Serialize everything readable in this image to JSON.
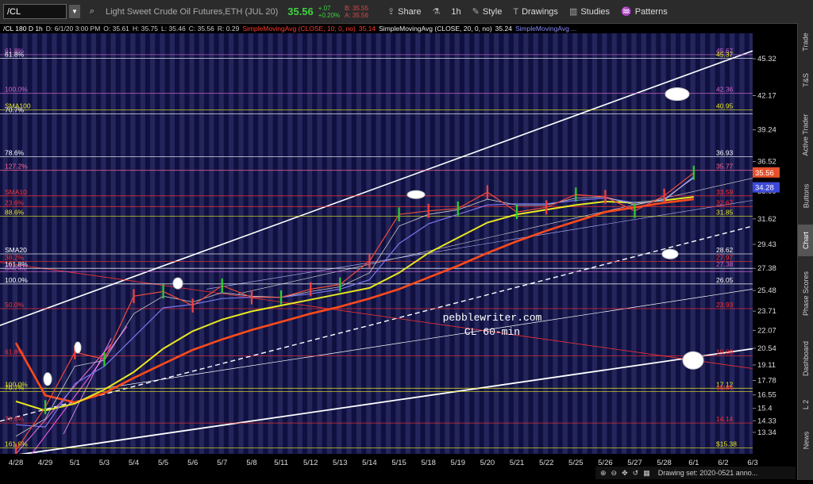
{
  "toolbar": {
    "symbol": "/CL",
    "description": "Light Sweet Crude Oil Futures,ETH (JUL 20)",
    "last": "35.56",
    "change": "+.07",
    "change_pct": "+0.20%",
    "bid": "B: 35.55",
    "ask": "A: 35.56",
    "share": "Share",
    "timeframe": "1h",
    "style": "Style",
    "drawings": "Drawings",
    "studies": "Studies",
    "patterns": "Patterns"
  },
  "header": {
    "info": "/CL 180 D 1h",
    "date": "D: 6/1/20 3:00 PM",
    "open": "O: 35.61",
    "high": "H: 35.75",
    "low": "L: 35.46",
    "close": "C: 35.56",
    "range": "R: 0.29",
    "sma10_label": "SimpleMovingAvg (CLOSE, 10, 0, no)",
    "sma10_val": "35.14",
    "sma20_label": "SimpleMovingAvg (CLOSE, 20, 0, no)",
    "sma20_val": "35.24",
    "sma_more": "SimpleMovingAvg ..."
  },
  "chart_data": {
    "type": "line",
    "x": [
      "4/28",
      "4/29",
      "5/1",
      "5/3",
      "5/4",
      "5/5",
      "5/6",
      "5/7",
      "5/8",
      "5/11",
      "5/12",
      "5/13",
      "5/14",
      "5/15",
      "5/18",
      "5/19",
      "5/20",
      "5/21",
      "5/22",
      "5/25",
      "5/26",
      "5/27",
      "5/28",
      "6/1",
      "6/2",
      "6/3"
    ],
    "price_ticks": [
      "45.32",
      "42.17",
      "39.24",
      "36.52",
      "33.99",
      "31.62",
      "29.43",
      "27.38",
      "25.48",
      "23.71",
      "22.07",
      "20.54",
      "19.11",
      "17.78",
      "16.55",
      "15.4",
      "14.33",
      "13.34"
    ],
    "series": [
      {
        "values": [
          11.8,
          15.5,
          20.2,
          19.6,
          25.0,
          25.4,
          24.2,
          25.9,
          24.9,
          24.9,
          25.6,
          26.0,
          28.0,
          32.0,
          32.3,
          32.5,
          33.9,
          32.2,
          32.6,
          33.7,
          33.5,
          32.3,
          33.6,
          35.56
        ]
      },
      {
        "name": "SMA10",
        "values": [
          13.0,
          14.5,
          19.0,
          19.5,
          23.5,
          25.0,
          24.5,
          25.3,
          25.0,
          24.9,
          25.4,
          25.8,
          27.0,
          31.0,
          32.0,
          32.4,
          33.3,
          32.8,
          32.8,
          33.4,
          33.5,
          32.8,
          33.3,
          35.14
        ]
      },
      {
        "name": "SMA20",
        "values": [
          14.0,
          13.8,
          17.5,
          19.0,
          21.5,
          24.0,
          24.3,
          24.8,
          24.9,
          24.9,
          25.2,
          25.6,
          26.4,
          29.5,
          31.2,
          32.0,
          32.8,
          32.9,
          32.9,
          33.2,
          33.4,
          33.0,
          33.2,
          35.24
        ]
      },
      {
        "name": "SMA50",
        "values": [
          16.0,
          15.2,
          15.8,
          17.0,
          18.5,
          20.5,
          22.0,
          23.0,
          23.7,
          24.2,
          24.7,
          25.2,
          25.7,
          27.0,
          28.7,
          30.0,
          31.3,
          32.0,
          32.4,
          32.8,
          33.1,
          33.0,
          33.2,
          33.5
        ]
      },
      {
        "name": "SMA100",
        "values": [
          21.0,
          16.5,
          15.9,
          16.7,
          18.0,
          19.2,
          20.4,
          21.3,
          22.1,
          22.8,
          23.5,
          24.1,
          24.8,
          25.6,
          26.6,
          27.6,
          28.7,
          29.7,
          30.6,
          31.4,
          32.2,
          32.6,
          33.0,
          33.3
        ]
      }
    ],
    "fib_levels": [
      {
        "label": "61.8%",
        "value": "45.67"
      },
      {
        "label": "61.8%",
        "value": "45.37"
      },
      {
        "label": "100.0%",
        "value": "42.36"
      },
      {
        "label": "SMA100",
        "value": "40.95"
      },
      {
        "label": "70.7%",
        "value": ""
      },
      {
        "label": "78.6%",
        "value": "36.93"
      },
      {
        "label": "127.2%",
        "value": "35.77"
      },
      {
        "label": "SMA10",
        "value": "33.59"
      },
      {
        "label": "23.6%",
        "value": "32.67"
      },
      {
        "label": "88.6%",
        "value": "31.85"
      },
      {
        "label": "SMA20",
        "value": "28.62"
      },
      {
        "label": "38.2%",
        "value": "27.97"
      },
      {
        "label": "161.8%",
        "value": "27.38"
      },
      {
        "label": "SMA50",
        "value": ""
      },
      {
        "label": "100.0%",
        "value": "26.05"
      },
      {
        "label": "50.0%",
        "value": "23.93"
      },
      {
        "label": "61.8%",
        "value": "19.89"
      },
      {
        "label": "100.0%",
        "value": "17.12"
      },
      {
        "label": "70.7%",
        "value": "16.84"
      },
      {
        "label": "78.6%",
        "value": "14.14"
      },
      {
        "label": "161.8%",
        "value": "$15.38"
      }
    ],
    "last_price": "35.56",
    "sma_tag": "34.28",
    "watermark_1": "pebblewriter.com",
    "watermark_2": "CL 60-min",
    "colors": {
      "price": "#f04a3a",
      "sma10": "#cccccc",
      "sma20": "#7777ee",
      "sma50": "#e8e820",
      "sma100": "#ff4a1a",
      "band": "#26285e"
    }
  },
  "sidebar": [
    "Trade",
    "T&S",
    "Active Trader",
    "Buttons",
    "Chart",
    "Phase Scores",
    "Dashboard",
    "L 2",
    "News"
  ],
  "footer": {
    "drawing_set": "Drawing set: 2020-0521 anno..."
  }
}
